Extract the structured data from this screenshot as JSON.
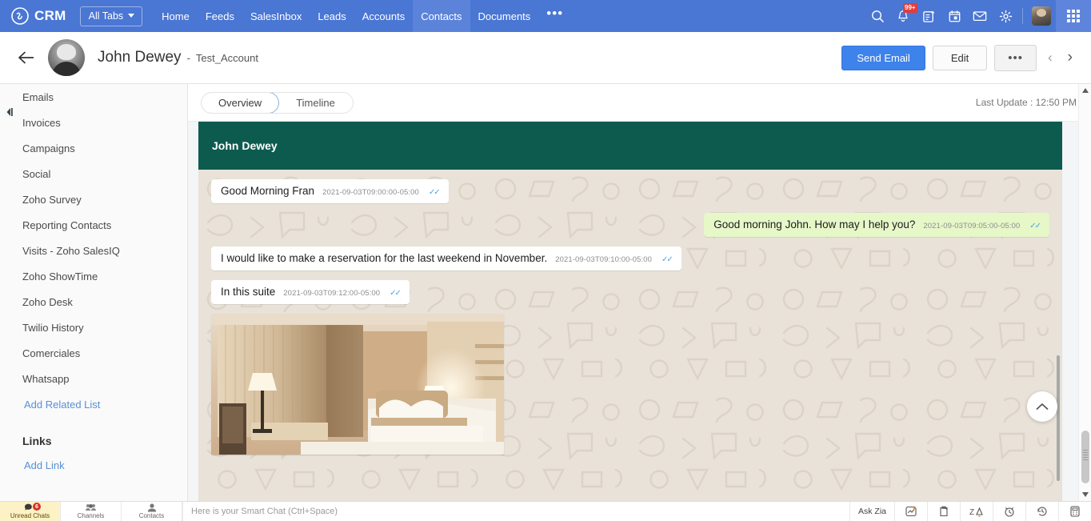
{
  "topnav": {
    "brand": "CRM",
    "brand_icon": "zoho-crm-logo-icon",
    "all_tabs": "All Tabs",
    "items": [
      {
        "label": "Home",
        "active": false
      },
      {
        "label": "Feeds",
        "active": false
      },
      {
        "label": "SalesInbox",
        "active": false
      },
      {
        "label": "Leads",
        "active": false
      },
      {
        "label": "Accounts",
        "active": false
      },
      {
        "label": "Contacts",
        "active": true
      },
      {
        "label": "Documents",
        "active": false
      }
    ],
    "more": "•••",
    "notification_badge": "99+",
    "icons": [
      "search-icon",
      "notifications-bell-icon",
      "add-note-icon",
      "calendar-icon",
      "mail-icon",
      "settings-gear-icon",
      "user-avatar",
      "app-switcher-icon"
    ],
    "accent": "#4a76d4"
  },
  "record_header": {
    "back_icon": "back-arrow-icon",
    "avatar": "contact-avatar",
    "name": "John Dewey",
    "separator": "-",
    "account": "Test_Account",
    "send_email": "Send Email",
    "edit": "Edit",
    "more": "•••",
    "prev_icon": "chevron-left-icon",
    "next_icon": "chevron-right-icon",
    "primary_color": "#3e82eb"
  },
  "sidebar": {
    "items": [
      "Emails",
      "Invoices",
      "Campaigns",
      "Social",
      "Zoho Survey",
      "Reporting Contacts",
      "Visits - Zoho SalesIQ",
      "Zoho ShowTime",
      "Zoho Desk",
      "Twilio History",
      "Comerciales",
      "Whatsapp"
    ],
    "add_related_list": "Add Related List",
    "links_heading": "Links",
    "add_link": "Add Link",
    "link_color": "#5a8fd6"
  },
  "main": {
    "tabs": [
      {
        "label": "Overview",
        "active": true
      },
      {
        "label": "Timeline",
        "active": false
      }
    ],
    "last_update": "Last Update : 12:50 PM"
  },
  "chat": {
    "header_name": "John Dewey",
    "header_color": "#0d5b4e",
    "background_color": "#e9e2d9",
    "outgoing_bubble_color": "#e6f7c8",
    "incoming_bubble_color": "#ffffff",
    "tick_color": "#4fa3e3",
    "messages": [
      {
        "text": "Good Morning Fran",
        "time": "2021-09-03T09:00:00-05:00",
        "direction": "in",
        "ticks": "✓✓"
      },
      {
        "text": "Good morning John. How may I help you?",
        "time": "2021-09-03T09:05:00-05:00",
        "direction": "out",
        "ticks": "✓✓"
      },
      {
        "text": "I would like to make a reservation for the last weekend in November.",
        "time": "2021-09-03T09:10:00-05:00",
        "direction": "in",
        "ticks": "✓✓"
      },
      {
        "text": "In this suite",
        "time": "2021-09-03T09:12:00-05:00",
        "direction": "in",
        "ticks": "✓✓"
      }
    ],
    "attachment": {
      "type": "image",
      "alt": "hotel-suite-photo"
    },
    "scroll_top_icon": "chevron-up-icon"
  },
  "bottombar": {
    "tabs": [
      {
        "label": "Unread Chats",
        "icon": "unread-chats-icon",
        "badge": "6",
        "active": true
      },
      {
        "label": "Channels",
        "icon": "channels-icon",
        "badge": "",
        "active": false
      },
      {
        "label": "Contacts",
        "icon": "contacts-icon",
        "badge": "",
        "active": false
      }
    ],
    "smart_chat_placeholder": "Here is your Smart Chat (Ctrl+Space)",
    "ask_zia": "Ask Zia",
    "right_icons": [
      "zia-insights-icon",
      "clipboard-icon",
      "zia-voice-icon",
      "reminder-clock-icon",
      "recent-history-icon",
      "calculator-icon"
    ]
  }
}
